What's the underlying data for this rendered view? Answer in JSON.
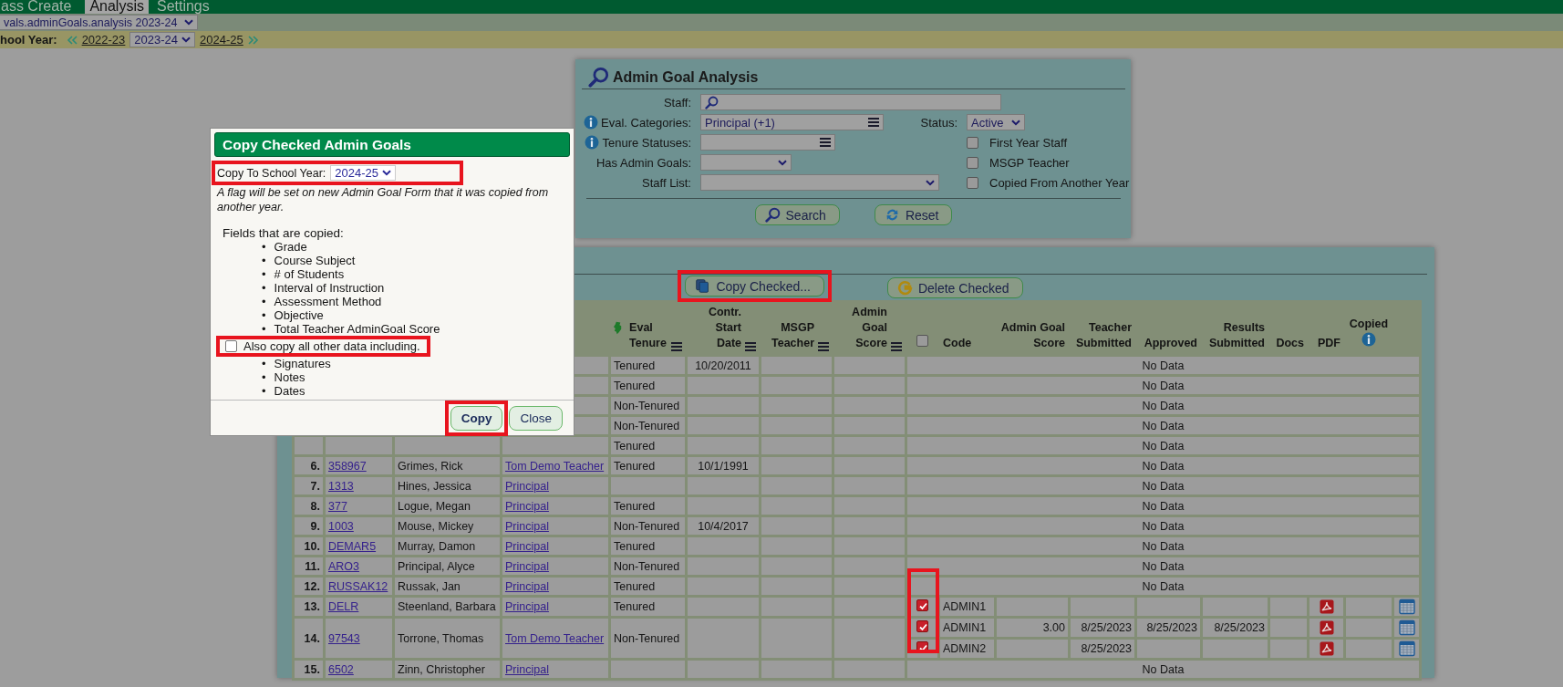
{
  "nav": [
    {
      "label": "ass Create",
      "selected": false
    },
    {
      "label": "Analysis",
      "selected": true
    },
    {
      "label": "Settings",
      "selected": false
    }
  ],
  "report_select": "vals.adminGoals.analysis 2023-24",
  "school_year": {
    "label": "hool Year:",
    "previous": "2022-23",
    "current": "2023-24",
    "next": "2024-25"
  },
  "search_panel": {
    "title": "Admin Goal Analysis",
    "staff": {
      "label": "Staff:"
    },
    "eval_categories": {
      "label": "Eval. Categories:",
      "value": "Principal (+1)"
    },
    "tenure_statuses": {
      "label": "Tenure Statuses:"
    },
    "has_admin_goals": {
      "label": "Has Admin Goals:"
    },
    "staff_list": {
      "label": "Staff List:"
    },
    "status": {
      "label": "Status:",
      "value": "Active"
    },
    "checkboxes": [
      {
        "label": "First Year Staff",
        "checked": false
      },
      {
        "label": "MSGP Teacher",
        "checked": false
      },
      {
        "label": "Copied From Another Year",
        "checked": false
      }
    ],
    "buttons": [
      "Search",
      "Reset"
    ]
  },
  "results": {
    "copy_button": "Copy Checked...",
    "delete_button": "Delete Checked",
    "staff_columns": [
      "Eval Tenure",
      "Contr. Start Date",
      "MSGP Teacher",
      "Admin Goal Score"
    ],
    "select_all_checked": false,
    "goal_columns": [
      "Code",
      "Admin Goal Score",
      "Teacher Submitted",
      "Approved",
      "Results Submitted",
      "Docs",
      "PDF",
      "Copied"
    ],
    "rows": [
      {
        "tenure": "Tenured",
        "start_date": "10/20/2011",
        "no_data": "No Data"
      },
      {
        "tenure": "Tenured",
        "no_data": "No Data"
      },
      {
        "tenure": "Non-Tenured",
        "no_data": "No Data"
      },
      {
        "tenure": "Non-Tenured",
        "no_data": "No Data"
      },
      {
        "tenure": "Tenured",
        "no_data": "No Data"
      },
      {
        "num": "6.",
        "id": "358967",
        "name": "Grimes, Rick",
        "category": "Tom Demo Teacher",
        "tenure": "Tenured",
        "start_date": "10/1/1991",
        "no_data": "No Data"
      },
      {
        "num": "7.",
        "id": "1313",
        "name": "Hines, Jessica",
        "category": "Principal",
        "no_data": "No Data"
      },
      {
        "num": "8.",
        "id": "377",
        "name": "Logue, Megan",
        "category": "Principal",
        "tenure": "Tenured",
        "no_data": "No Data"
      },
      {
        "num": "9.",
        "id": "1003",
        "name": "Mouse, Mickey",
        "category": "Principal",
        "tenure": "Non-Tenured",
        "start_date": "10/4/2017",
        "no_data": "No Data"
      },
      {
        "num": "10.",
        "id": "DEMAR5",
        "name": "Murray, Damon",
        "category": "Principal",
        "tenure": "Tenured",
        "no_data": "No Data"
      },
      {
        "num": "11.",
        "id": "ARO3",
        "name": "Principal, Alyce",
        "category": "Principal",
        "tenure": "Non-Tenured",
        "no_data": "No Data"
      },
      {
        "num": "12.",
        "id": "RUSSAK12",
        "name": "Russak, Jan",
        "category": "Principal",
        "tenure": "Tenured",
        "no_data": "No Data"
      },
      {
        "num": "13.",
        "id": "DELR",
        "name": "Steenland, Barbara",
        "category": "Principal",
        "tenure": "Tenured",
        "goals": [
          {
            "checked": true,
            "code": "ADMIN1"
          }
        ]
      },
      {
        "num": "14.",
        "id": "97543",
        "name": "Torrone, Thomas",
        "category": "Tom Demo Teacher",
        "tenure": "Non-Tenured",
        "goals": [
          {
            "checked": true,
            "code": "ADMIN1",
            "score": "3.00",
            "teacher_submitted": "8/25/2023",
            "approved": "8/25/2023",
            "results_submitted": "8/25/2023"
          },
          {
            "checked": true,
            "code": "ADMIN2",
            "teacher_submitted": "8/25/2023"
          }
        ]
      },
      {
        "num": "15.",
        "id": "6502",
        "name": "Zinn, Christopher",
        "category": "Principal",
        "no_data": "No Data"
      }
    ]
  },
  "dialog": {
    "title": "Copy Checked Admin Goals",
    "year_label": "Copy To School Year:",
    "year_value": "2024-25",
    "note": "A flag will be set on new Admin Goal Form that it was copied from another year.",
    "fields_label": "Fields that are copied:",
    "bullet": "•",
    "fields": [
      "Grade",
      "Course Subject",
      "# of Students",
      "Interval of Instruction",
      "Assessment Method",
      "Objective",
      "Total Teacher AdminGoal Score"
    ],
    "copy_all": {
      "label": "Also copy all other data including.",
      "checked": false
    },
    "other_fields": [
      "Signatures",
      "Notes",
      "Dates"
    ],
    "buttons": [
      "Copy",
      "Close"
    ]
  }
}
